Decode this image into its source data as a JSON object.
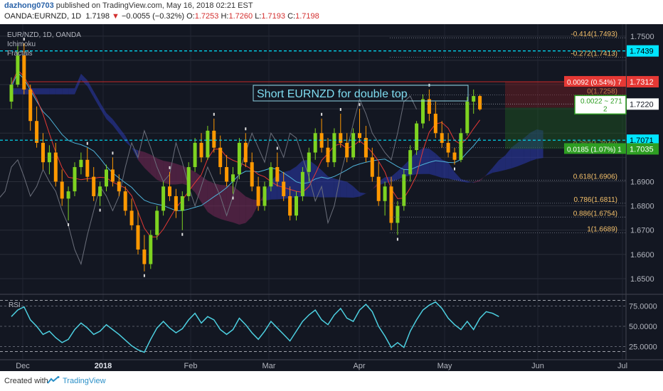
{
  "header": {
    "publisher": "dazhong0703",
    "published_text": "published on TradingView.com, May 16, 2018 02:21 EST",
    "symbol": "OANDA:EURNZD, 1D",
    "last": "1.7198",
    "change": "−0.0055 (−0.32%)",
    "open_label": "O:",
    "open": "1.7253",
    "high_label": "H:",
    "high": "1.7260",
    "low_label": "L:",
    "low": "1.7193",
    "close_label": "C:",
    "close": "1.7198"
  },
  "legend": {
    "symbol_line": "EUR/NZD, 1D, OANDA",
    "ichimoku": "Ichimoku",
    "fractals": "Fractals"
  },
  "annotation": {
    "text": "Short EURNZD for double top"
  },
  "colors": {
    "background": "#131722",
    "bull": "#7ed321",
    "bear": "#ff9800",
    "fib": "#f5c16b",
    "cyan": "#00e5ff",
    "red_label": "#e53935",
    "green_label": "#2e9e22",
    "rsi": "#4dd0e1",
    "cloud_bull": "#2b3bb0",
    "cloud_bear": "#7a2a5a",
    "tenkan": "#e53935",
    "kijun": "#4fb3d9"
  },
  "chart_data": {
    "type": "candlestick",
    "x_labels": [
      "Dec",
      "2018",
      "Feb",
      "Mar",
      "Apr",
      "May",
      "Jun",
      "Jul"
    ],
    "ylim": [
      1.645,
      1.752
    ],
    "y_ticks": [
      "1.7500",
      "1.7400",
      "1.7300",
      "1.7200",
      "1.7100",
      "1.7000",
      "1.6900",
      "1.6800",
      "1.6700",
      "1.6600",
      "1.6500"
    ],
    "candles_approx": [
      [
        1.723,
        1.733,
        1.72,
        1.73
      ],
      [
        1.73,
        1.746,
        1.729,
        1.742
      ],
      [
        1.742,
        1.747,
        1.726,
        1.728
      ],
      [
        1.728,
        1.73,
        1.711,
        1.715
      ],
      [
        1.715,
        1.721,
        1.704,
        1.706
      ],
      [
        1.706,
        1.71,
        1.695,
        1.698
      ],
      [
        1.698,
        1.705,
        1.693,
        1.702
      ],
      [
        1.702,
        1.706,
        1.688,
        1.69
      ],
      [
        1.69,
        1.695,
        1.68,
        1.683
      ],
      [
        1.683,
        1.688,
        1.674,
        1.686
      ],
      [
        1.686,
        1.698,
        1.684,
        1.696
      ],
      [
        1.696,
        1.702,
        1.693,
        1.699
      ],
      [
        1.699,
        1.704,
        1.69,
        1.692
      ],
      [
        1.692,
        1.696,
        1.682,
        1.684
      ],
      [
        1.684,
        1.69,
        1.68,
        1.688
      ],
      [
        1.688,
        1.697,
        1.686,
        1.695
      ],
      [
        1.695,
        1.7,
        1.688,
        1.69
      ],
      [
        1.69,
        1.693,
        1.684,
        1.686
      ],
      [
        1.686,
        1.688,
        1.676,
        1.678
      ],
      [
        1.678,
        1.683,
        1.67,
        1.672
      ],
      [
        1.672,
        1.678,
        1.66,
        1.662
      ],
      [
        1.662,
        1.668,
        1.653,
        1.656
      ],
      [
        1.656,
        1.67,
        1.654,
        1.668
      ],
      [
        1.668,
        1.68,
        1.666,
        1.678
      ],
      [
        1.678,
        1.69,
        1.676,
        1.688
      ],
      [
        1.688,
        1.694,
        1.682,
        1.684
      ],
      [
        1.684,
        1.687,
        1.675,
        1.678
      ],
      [
        1.678,
        1.686,
        1.67,
        1.684
      ],
      [
        1.684,
        1.698,
        1.682,
        1.696
      ],
      [
        1.696,
        1.708,
        1.694,
        1.706
      ],
      [
        1.706,
        1.71,
        1.698,
        1.7
      ],
      [
        1.7,
        1.713,
        1.699,
        1.711
      ],
      [
        1.711,
        1.716,
        1.702,
        1.704
      ],
      [
        1.704,
        1.709,
        1.693,
        1.696
      ],
      [
        1.696,
        1.701,
        1.688,
        1.69
      ],
      [
        1.69,
        1.696,
        1.685,
        1.693
      ],
      [
        1.693,
        1.708,
        1.691,
        1.706
      ],
      [
        1.706,
        1.71,
        1.696,
        1.698
      ],
      [
        1.698,
        1.702,
        1.686,
        1.688
      ],
      [
        1.688,
        1.692,
        1.678,
        1.68
      ],
      [
        1.68,
        1.69,
        1.678,
        1.688
      ],
      [
        1.688,
        1.698,
        1.686,
        1.696
      ],
      [
        1.696,
        1.702,
        1.688,
        1.69
      ],
      [
        1.69,
        1.694,
        1.682,
        1.684
      ],
      [
        1.684,
        1.688,
        1.674,
        1.676
      ],
      [
        1.676,
        1.686,
        1.674,
        1.684
      ],
      [
        1.684,
        1.696,
        1.682,
        1.694
      ],
      [
        1.694,
        1.704,
        1.69,
        1.702
      ],
      [
        1.702,
        1.712,
        1.699,
        1.71
      ],
      [
        1.71,
        1.716,
        1.702,
        1.704
      ],
      [
        1.704,
        1.708,
        1.696,
        1.698
      ],
      [
        1.698,
        1.712,
        1.696,
        1.71
      ],
      [
        1.71,
        1.718,
        1.704,
        1.706
      ],
      [
        1.706,
        1.71,
        1.698,
        1.7
      ],
      [
        1.7,
        1.712,
        1.699,
        1.71
      ],
      [
        1.71,
        1.72,
        1.706,
        1.708
      ],
      [
        1.708,
        1.713,
        1.698,
        1.7
      ],
      [
        1.7,
        1.704,
        1.69,
        1.692
      ],
      [
        1.692,
        1.698,
        1.68,
        1.682
      ],
      [
        1.682,
        1.69,
        1.676,
        1.688
      ],
      [
        1.688,
        1.692,
        1.67,
        1.673
      ],
      [
        1.673,
        1.682,
        1.668,
        1.68
      ],
      [
        1.68,
        1.695,
        1.678,
        1.693
      ],
      [
        1.693,
        1.705,
        1.69,
        1.703
      ],
      [
        1.703,
        1.715,
        1.701,
        1.714
      ],
      [
        1.714,
        1.726,
        1.712,
        1.724
      ],
      [
        1.724,
        1.728,
        1.715,
        1.718
      ],
      [
        1.718,
        1.723,
        1.708,
        1.71
      ],
      [
        1.71,
        1.715,
        1.704,
        1.706
      ],
      [
        1.706,
        1.71,
        1.7,
        1.702
      ],
      [
        1.702,
        1.704,
        1.697,
        1.699
      ],
      [
        1.699,
        1.712,
        1.698,
        1.71
      ],
      [
        1.71,
        1.725,
        1.709,
        1.723
      ],
      [
        1.723,
        1.728,
        1.718,
        1.7253
      ],
      [
        1.7253,
        1.726,
        1.7193,
        1.7198
      ]
    ],
    "price_labels": [
      {
        "text": "1.7439",
        "value": 1.7439,
        "kind": "cyan"
      },
      {
        "text": "1.7312",
        "value": 1.7312,
        "kind": "red"
      },
      {
        "text": "1.7220",
        "value": 1.722,
        "kind": "plain"
      },
      {
        "text": "1.7071",
        "value": 1.7071,
        "kind": "cyan"
      },
      {
        "text": "1.7035",
        "value": 1.7035,
        "kind": "green"
      }
    ],
    "fib_levels": [
      {
        "text": "-0.414(1.7493)",
        "value": 1.7493
      },
      {
        "text": "-0.272(1.7413)",
        "value": 1.7413
      },
      {
        "text": "0(1.7258)",
        "value": 1.7258
      },
      {
        "text": "0.382(1.7040)",
        "value": 1.704
      },
      {
        "text": "0.618(1.6906)",
        "value": 1.6906
      },
      {
        "text": "0.786(1.6811)",
        "value": 1.6811
      },
      {
        "text": "0.886(1.6754)",
        "value": 1.6754
      },
      {
        "text": "1(1.6689)",
        "value": 1.6689
      }
    ],
    "position_tool": {
      "stop_label": "0.0092 (0.54%) 7",
      "target_label": "0.0185 (1.07%) 1",
      "ratio_line1": "0.0022 ~ 271",
      "ratio_line2": "2"
    },
    "rsi": {
      "name": "RSI",
      "ylim": [
        15,
        85
      ],
      "y_ticks": [
        "75.0000",
        "50.0000",
        "25.0000"
      ],
      "values": [
        62,
        70,
        74,
        58,
        50,
        40,
        44,
        36,
        30,
        34,
        46,
        54,
        48,
        40,
        44,
        52,
        46,
        40,
        33,
        26,
        21,
        18,
        34,
        48,
        56,
        48,
        42,
        47,
        58,
        66,
        54,
        62,
        58,
        46,
        40,
        46,
        60,
        52,
        42,
        34,
        44,
        56,
        48,
        40,
        32,
        44,
        56,
        64,
        70,
        58,
        52,
        64,
        72,
        60,
        56,
        70,
        77,
        68,
        50,
        38,
        24,
        30,
        24,
        44,
        58,
        70,
        76,
        80,
        72,
        60,
        52,
        46,
        56,
        46,
        60,
        68,
        66,
        62
      ]
    }
  },
  "footer": {
    "created_with": "Created with",
    "brand": "TradingView"
  }
}
